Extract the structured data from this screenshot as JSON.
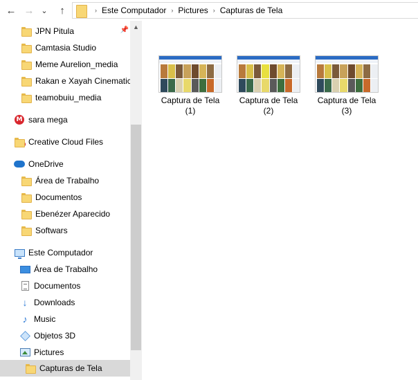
{
  "nav": {
    "back_icon": "←",
    "forward_icon": "→",
    "recent_icon": "⌄",
    "up_icon": "↑"
  },
  "address": {
    "separator": "›",
    "crumbs": [
      "Este Computador",
      "Pictures",
      "Capturas de Tela"
    ]
  },
  "sidebar": {
    "items": [
      {
        "label": "JPN Pitula",
        "icon": "folder-icon",
        "pinned": true
      },
      {
        "label": "Camtasia Studio",
        "icon": "folder-icon"
      },
      {
        "label": "Meme Aurelion_media",
        "icon": "folder-icon"
      },
      {
        "label": "Rakan e Xayah Cinematic M",
        "icon": "folder-icon"
      },
      {
        "label": "teamobuiu_media",
        "icon": "folder-icon"
      },
      {
        "label": "sara mega",
        "icon": "mega-icon"
      },
      {
        "label": "Creative Cloud Files",
        "icon": "creative-cloud-folder-icon"
      },
      {
        "label": "OneDrive",
        "icon": "onedrive-cloud-icon"
      },
      {
        "label": "Área de Trabalho",
        "icon": "folder-icon"
      },
      {
        "label": "Documentos",
        "icon": "folder-icon"
      },
      {
        "label": "Ebenézer Aparecido",
        "icon": "folder-icon"
      },
      {
        "label": "Softwars",
        "icon": "folder-icon"
      },
      {
        "label": "Este Computador",
        "icon": "computer-icon"
      },
      {
        "label": "Área de Trabalho",
        "icon": "desktop-icon"
      },
      {
        "label": "Documentos",
        "icon": "documents-icon"
      },
      {
        "label": "Downloads",
        "icon": "downloads-icon"
      },
      {
        "label": "Music",
        "icon": "music-icon"
      },
      {
        "label": "Objetos 3D",
        "icon": "objects-3d-icon"
      },
      {
        "label": "Pictures",
        "icon": "pictures-icon"
      },
      {
        "label": "Capturas de Tela",
        "icon": "folder-icon",
        "selected": true
      }
    ],
    "pin_icon": "📌",
    "scroll_up_icon": "▲"
  },
  "files": [
    {
      "name_line1": "Captura de Tela",
      "name_line2": "(1)"
    },
    {
      "name_line1": "Captura de Tela",
      "name_line2": "(2)"
    },
    {
      "name_line1": "Captura de Tela",
      "name_line2": "(3)"
    }
  ],
  "colors": {
    "selected_bg": "#d9d9d9",
    "onedrive_blue": "#1f74cc",
    "mega_red": "#d9272e",
    "folder_yellow": "#f8d775"
  }
}
